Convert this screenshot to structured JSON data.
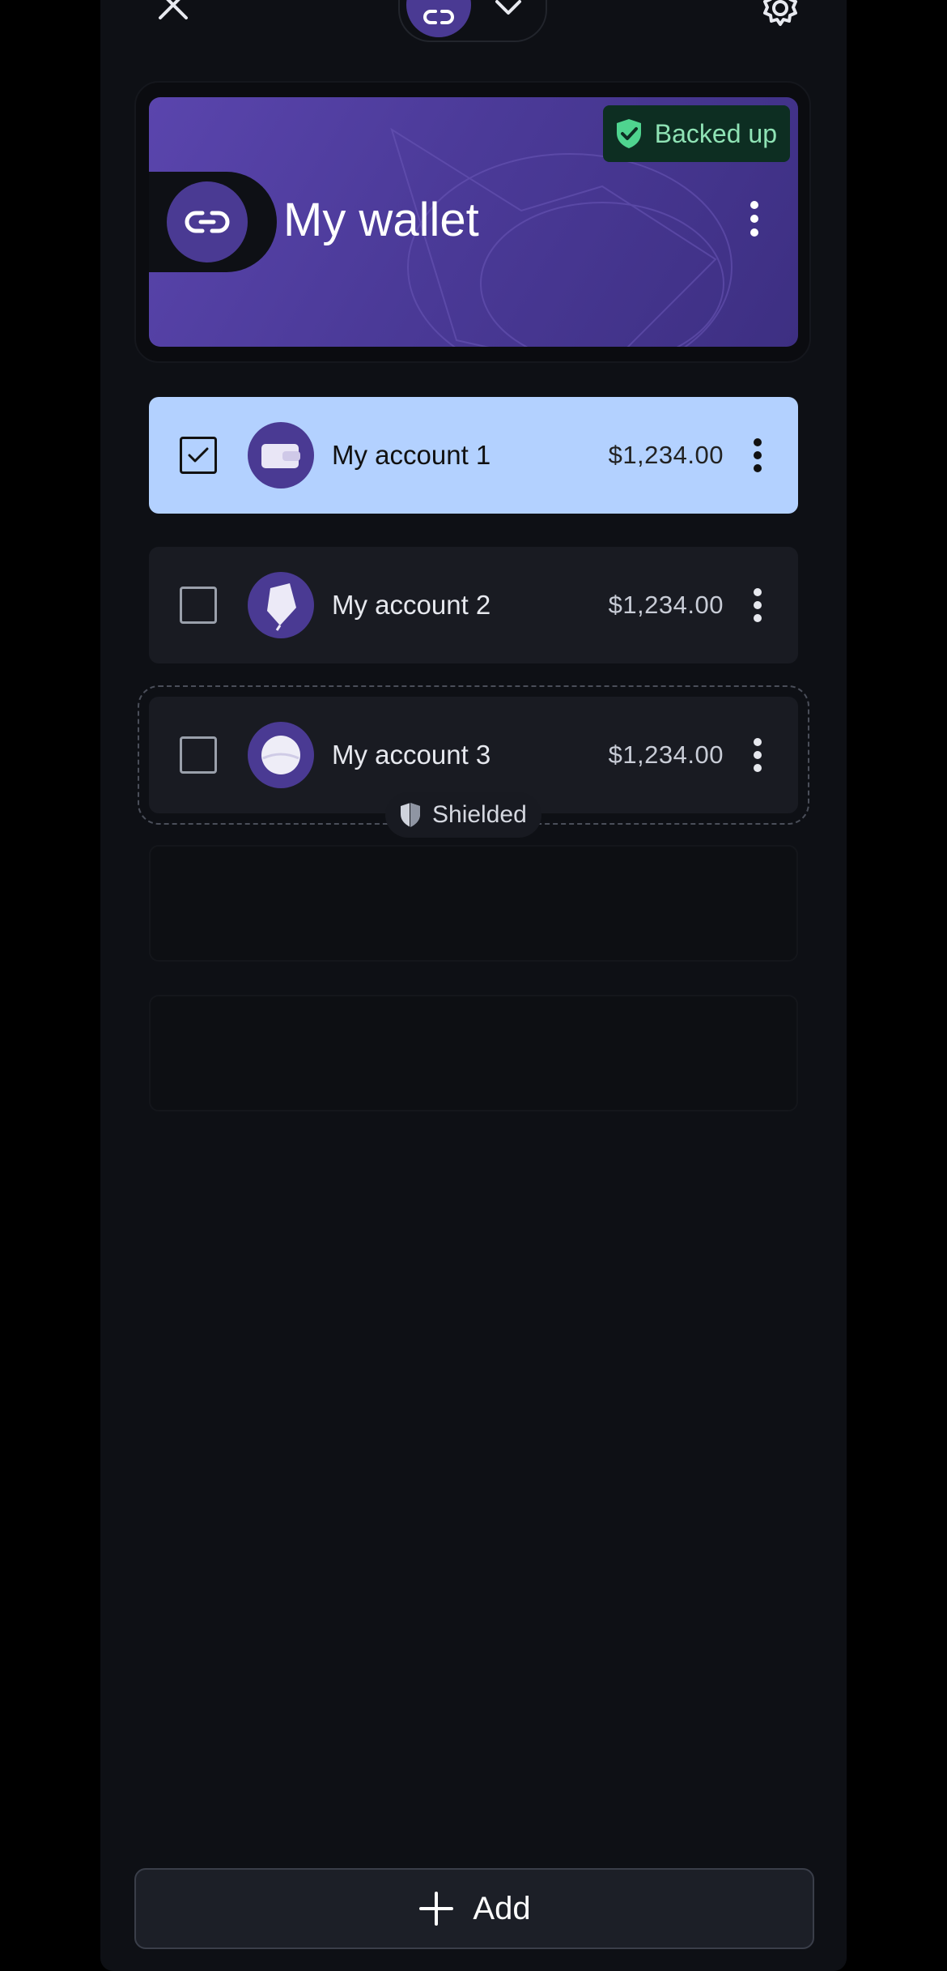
{
  "header": {
    "close_icon": "close-icon",
    "wallet_switcher_icon": "link-icon",
    "chevron_icon": "chevron-down-icon",
    "settings_icon": "gear-icon"
  },
  "wallet": {
    "title": "My wallet",
    "backup_status": "Backed up",
    "backup_icon": "shield-check-icon",
    "avatar_icon": "link-icon",
    "menu_icon": "more-vertical-icon",
    "card_color": "#4b3a98"
  },
  "accounts": [
    {
      "name": "My account 1",
      "balance": "$1,234.00",
      "selected": true,
      "avatar_icon": "wallet-icon"
    },
    {
      "name": "My account 2",
      "balance": "$1,234.00",
      "selected": false,
      "avatar_icon": "balloon-icon"
    },
    {
      "name": "My account 3",
      "balance": "$1,234.00",
      "selected": false,
      "avatar_icon": "orb-icon",
      "tag": "Shielded"
    }
  ],
  "add_button": {
    "label": "Add",
    "icon": "plus-icon"
  },
  "colors": {
    "background": "#0e1015",
    "selected_row": "#b3d1ff",
    "accent_purple": "#4a3a93",
    "backed_up_green": "#8fe3b5"
  }
}
